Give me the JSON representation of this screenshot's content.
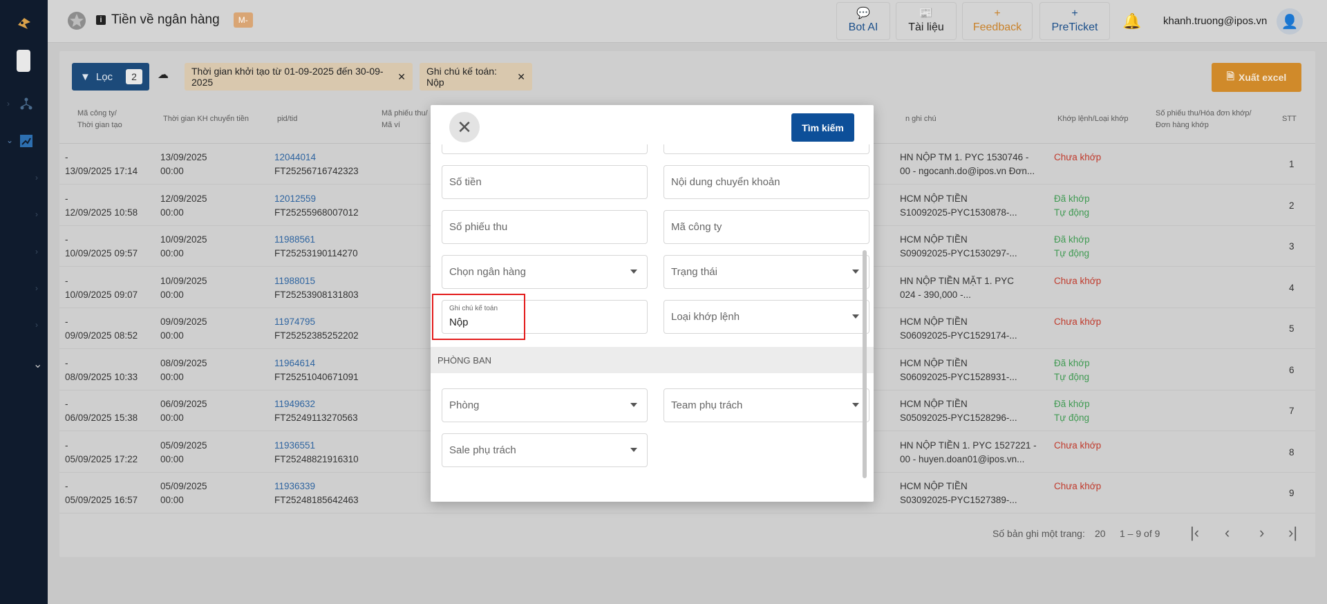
{
  "header": {
    "title": "Tiền về ngân hàng",
    "badge": "M-",
    "buttons": [
      {
        "label": "Bot AI",
        "icon": "chat-bubble-icon"
      },
      {
        "label": "Tài liệu",
        "icon": "book-icon"
      },
      {
        "label": "Feedback",
        "icon": "plus-icon"
      },
      {
        "label": "PreTicket",
        "icon": "plus-icon"
      }
    ],
    "user_email": "khanh.truong@ipos.vn",
    "colors": {
      "feedback": "#c9822b",
      "link_blue": "#1b4f8a"
    }
  },
  "filters": {
    "filter_label": "Lọc",
    "filter_count": "2",
    "chips": [
      "Thời gian khởi tạo từ 01-09-2025 đến 30-09-2025",
      "Ghi chú kế toán: Nộp"
    ],
    "export_label": "Xuất excel"
  },
  "table": {
    "headers": {
      "company": [
        "Mã công ty/",
        "Thời gian tạo"
      ],
      "transfer_time": "Thời gian KH chuyển tiền",
      "pid": "pid/tid",
      "receipt": [
        "Mã phiếu thu/",
        "Mã ví"
      ],
      "note": "n ghi chú",
      "match": "Khớp lệnh/Loại khớp",
      "order": [
        "Số phiếu thu/Hóa đơn khớp/",
        "Đơn hàng khớp"
      ],
      "stt": "STT"
    },
    "rows": [
      {
        "c1a": "-",
        "c1b": "13/09/2025 17:14",
        "c2a": "13/09/2025",
        "c2b": "00:00",
        "pid": "12044014",
        "tid": "FT25256716742323",
        "note1": "HN NỘP TM 1. PYC 1530746 -",
        "note2": "00 - ngocanh.do@ipos.vn Đơn...",
        "st1": "Chưa khớp",
        "st2": "",
        "stt": "1"
      },
      {
        "c1a": "-",
        "c1b": "12/09/2025 10:58",
        "c2a": "12/09/2025",
        "c2b": "00:00",
        "pid": "12012559",
        "tid": "FT25255968007012",
        "note1": "HCM NỘP TIỀN",
        "note2": "S10092025-PYC1530878-...",
        "st1": "Đã khớp",
        "st2": "Tự động",
        "stt": "2"
      },
      {
        "c1a": "-",
        "c1b": "10/09/2025 09:57",
        "c2a": "10/09/2025",
        "c2b": "00:00",
        "pid": "11988561",
        "tid": "FT25253190114270",
        "note1": "HCM NỘP TIỀN",
        "note2": "S09092025-PYC1530297-...",
        "st1": "Đã khớp",
        "st2": "Tự động",
        "stt": "3"
      },
      {
        "c1a": "-",
        "c1b": "10/09/2025 09:07",
        "c2a": "10/09/2025",
        "c2b": "00:00",
        "pid": "11988015",
        "tid": "FT25253908131803",
        "note1": "HN NỘP TIỀN MẶT 1. PYC",
        "note2": "024 - 390,000 -...",
        "st1": "Chưa khớp",
        "st2": "",
        "stt": "4"
      },
      {
        "c1a": "-",
        "c1b": "09/09/2025 08:52",
        "c2a": "09/09/2025",
        "c2b": "00:00",
        "pid": "11974795",
        "tid": "FT25252385252202",
        "note1": "HCM NỘP TIỀN",
        "note2": "S06092025-PYC1529174-...",
        "st1": "Chưa khớp",
        "st2": "",
        "stt": "5"
      },
      {
        "c1a": "-",
        "c1b": "08/09/2025 10:33",
        "c2a": "08/09/2025",
        "c2b": "00:00",
        "pid": "11964614",
        "tid": "FT25251040671091",
        "note1": "HCM NỘP TIỀN",
        "note2": "S06092025-PYC1528931-...",
        "st1": "Đã khớp",
        "st2": "Tự động",
        "stt": "6"
      },
      {
        "c1a": "-",
        "c1b": "06/09/2025 15:38",
        "c2a": "06/09/2025",
        "c2b": "00:00",
        "pid": "11949632",
        "tid": "FT25249113270563",
        "note1": "HCM NỘP TIỀN",
        "note2": "S05092025-PYC1528296-...",
        "st1": "Đã khớp",
        "st2": "Tự động",
        "stt": "7"
      },
      {
        "c1a": "-",
        "c1b": "05/09/2025 17:22",
        "c2a": "05/09/2025",
        "c2b": "00:00",
        "pid": "11936551",
        "tid": "FT25248821916310",
        "note1": "HN NỘP TIỀN 1. PYC 1527221 -",
        "note2": "00 - huyen.doan01@ipos.vn...",
        "st1": "Chưa khớp",
        "st2": "",
        "stt": "8"
      },
      {
        "c1a": "-",
        "c1b": "05/09/2025 16:57",
        "c2a": "05/09/2025",
        "c2b": "00:00",
        "pid": "11936339",
        "tid": "FT25248185642463",
        "note1": "HCM NỘP TIỀN",
        "note2": "S03092025-PYC1527389-...",
        "st1": "Chưa khớp",
        "st2": "",
        "stt": "9"
      }
    ],
    "pager": {
      "rows_per_page_label": "Số bản ghi một trang:",
      "rows_per_page": "20",
      "range": "1 – 9 of 9"
    }
  },
  "modal": {
    "search_label": "Tìm kiếm",
    "fields": {
      "amount": "Số tiền",
      "transfer_content": "Nội dung chuyển khoản",
      "receipt_no": "Số phiếu thu",
      "company_code": "Mã công ty",
      "bank": "Chọn ngân hàng",
      "status": "Trạng thái",
      "accounting_note_label": "Ghi chú kế toán",
      "accounting_note_value": "Nộp",
      "match_type": "Loại khớp lệnh",
      "department": "Phòng",
      "team": "Team phụ trách",
      "sale": "Sale phụ trách"
    },
    "section_title": "PHÒNG BAN"
  }
}
